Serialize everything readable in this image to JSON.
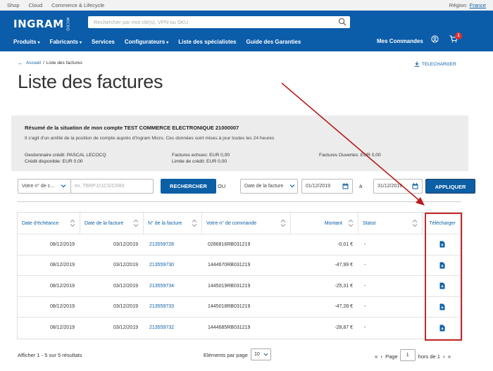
{
  "topbar": {
    "links": [
      "Shop",
      "Cloud",
      "Commerce & Lifecycle"
    ],
    "region_label": "Région:",
    "region_value": "France"
  },
  "header": {
    "logo": "INGRAM",
    "logo_tm": "MICRO",
    "search_placeholder": "Rechercher par mot clé(s), VPN ou SKU",
    "nav": [
      "Produits",
      "Fabricants",
      "Services",
      "Configurateurs",
      "Liste des spécialistes",
      "Guide des Garanties"
    ],
    "my_orders": "Mes Commandes",
    "cart_count": "1"
  },
  "breadcrumb": {
    "home": "Accueil",
    "sep": "/",
    "current": "Liste des factures"
  },
  "download_top": "TELECHARGER",
  "page_title": "Liste des factures",
  "summary": {
    "title": "Résumé de la situation de mon compte TEST COMMERCE ELECTRONIQUE 21000007",
    "description": "Il s'agit d'un arrêté de la position de compte auprès d'Ingram Micro. Ces données sont mises à jour toutes les 24 heures",
    "credit_manager": "Gestionnaire crédit: PASCAL LECOCQ",
    "credit_available": "Crédit disponible: EUR 0,00",
    "overdue": "Factures echues: EUR 0,00",
    "credit_limit": "Limite de crédit: EUR 0,00",
    "open_invoices": "Factures Ouvertes: EUR 0,00"
  },
  "filters": {
    "type_select": "Votre n° de c...",
    "input_placeholder": "ex. TBRPJ21CS/CR83",
    "search_button": "RECHERCHER",
    "or_label": "OU",
    "date_select": "Date de la facture",
    "date_from": "01/12/2019",
    "date_to_label": "à",
    "date_to": "31/12/2019",
    "apply_button": "APPLIQUER"
  },
  "table": {
    "headers": [
      "Date d'échéance",
      "Date de la facture",
      "N° de la facture",
      "Votre n° de commande",
      "Montant",
      "Statut",
      "Télécharger"
    ],
    "rows": [
      [
        "08/12/2019",
        "03/12/2019",
        "213559728",
        "0286816RB031219",
        "-0,01 €",
        "-"
      ],
      [
        "08/12/2019",
        "03/12/2019",
        "213559730",
        "1444670RB031219",
        "-47,99 €",
        "-"
      ],
      [
        "08/12/2019",
        "03/12/2019",
        "213559734",
        "1445019RB031219",
        "-25,31 €",
        "-"
      ],
      [
        "08/12/2019",
        "03/12/2019",
        "213559733",
        "1445018RB031219",
        "-47,28 €",
        "-"
      ],
      [
        "08/12/2019",
        "03/12/2019",
        "213559732",
        "1444685RB031219",
        "-28,87 €",
        "-"
      ]
    ]
  },
  "footer": {
    "results": "Afficher 1 - 5 sur 5 résultats",
    "per_page_label": "Eléments par page",
    "per_page_value": "10",
    "page_label": "Page",
    "page_value": "1",
    "page_total": "hors de 1"
  },
  "colors": {
    "brand_blue": "#0b5ca9",
    "highlight_red": "#c62828"
  }
}
